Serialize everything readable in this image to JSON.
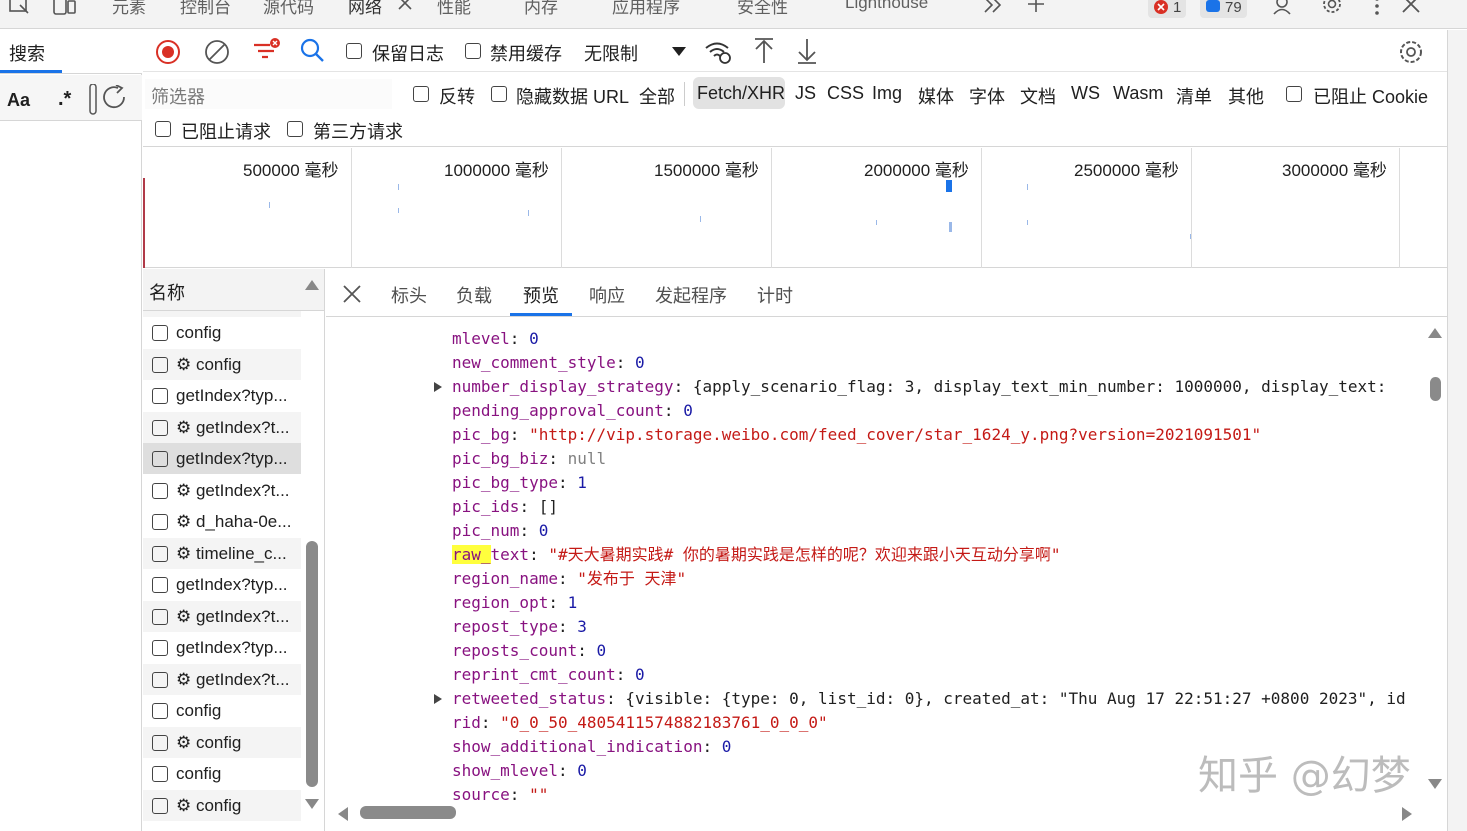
{
  "top_tabs": [
    "元素",
    "控制台",
    "源代码",
    "网络",
    "性能",
    "内存",
    "应用程序",
    "安全性",
    "Lighthouse"
  ],
  "errors_count": "1",
  "messages_count": "79",
  "left": {
    "search_tab": "搜索",
    "aa": "Aa",
    "regex": ".*"
  },
  "toolbar": {
    "preserve_log": "保留日志",
    "disable_cache": "禁用缓存",
    "throttle": "无限制"
  },
  "filter": {
    "placeholder": "筛选器",
    "invert": "反转",
    "hide_data_url": "隐藏数据 URL",
    "types": [
      "全部",
      "Fetch/XHR",
      "JS",
      "CSS",
      "Img",
      "媒体",
      "字体",
      "文档",
      "WS",
      "Wasm",
      "清单",
      "其他"
    ],
    "blocked_cookies": "已阻止 Cookie",
    "blocked_requests": "已阻止请求",
    "third_party": "第三方请求"
  },
  "timeline_ticks": [
    "500000 毫秒",
    "1000000 毫秒",
    "1500000 毫秒",
    "2000000 毫秒",
    "2500000 毫秒",
    "3000000 毫秒"
  ],
  "name_header": "名称",
  "requests": [
    "config",
    "⚙ config",
    "getIndex?typ...",
    "⚙ getIndex?t...",
    "getIndex?typ...",
    "⚙ getIndex?t...",
    "⚙ d_haha-0e...",
    "⚙ timeline_c...",
    "getIndex?typ...",
    "⚙ getIndex?t...",
    "getIndex?typ...",
    "⚙ getIndex?t...",
    "config",
    "⚙ config",
    "config",
    "⚙ config"
  ],
  "preview_tabs": [
    "标头",
    "负载",
    "预览",
    "响应",
    "发起程序",
    "计时"
  ],
  "json_lines": [
    {
      "key": "mlevel",
      "val": "0",
      "type": "n"
    },
    {
      "key": "new_comment_style",
      "val": "0",
      "type": "n"
    },
    {
      "key": "number_display_strategy",
      "val": "{apply_scenario_flag: 3, display_text_min_number: 1000000, display_text: ",
      "type": "p",
      "expand": true
    },
    {
      "key": "pending_approval_count",
      "val": "0",
      "type": "n"
    },
    {
      "key": "pic_bg",
      "val": "\"http://vip.storage.weibo.com/feed_cover/star_1624_y.png?version=2021091501\"",
      "type": "s"
    },
    {
      "key": "pic_bg_biz",
      "val": "null",
      "type": "nul"
    },
    {
      "key": "pic_bg_type",
      "val": "1",
      "type": "n"
    },
    {
      "key": "pic_ids",
      "val": "[]",
      "type": "p"
    },
    {
      "key": "pic_num",
      "val": "0",
      "type": "n"
    },
    {
      "key": "raw_text",
      "val": "\"#天大暑期实践# 你的暑期实践是怎样的呢？欢迎来跟小天互动分享啊\"",
      "type": "s"
    },
    {
      "key": "region_name",
      "val": "\"发布于 天津\"",
      "type": "s"
    },
    {
      "key": "region_opt",
      "val": "1",
      "type": "n"
    },
    {
      "key": "repost_type",
      "val": "3",
      "type": "n"
    },
    {
      "key": "reposts_count",
      "val": "0",
      "type": "n"
    },
    {
      "key": "reprint_cmt_count",
      "val": "0",
      "type": "n"
    },
    {
      "key": "retweeted_status",
      "val": "{visible: {type: 0, list_id: 0}, created_at: \"Thu Aug 17 22:51:27 +0800 2023\", id",
      "type": "p",
      "expand": true
    },
    {
      "key": "rid",
      "val": "\"0_0_50_4805411574882183761_0_0_0\"",
      "type": "s"
    },
    {
      "key": "show_additional_indication",
      "val": "0",
      "type": "n"
    },
    {
      "key": "show_mlevel",
      "val": "0",
      "type": "n"
    },
    {
      "key": "source",
      "val": "\"\"",
      "type": "s"
    }
  ],
  "watermark": "知乎 @幻梦"
}
